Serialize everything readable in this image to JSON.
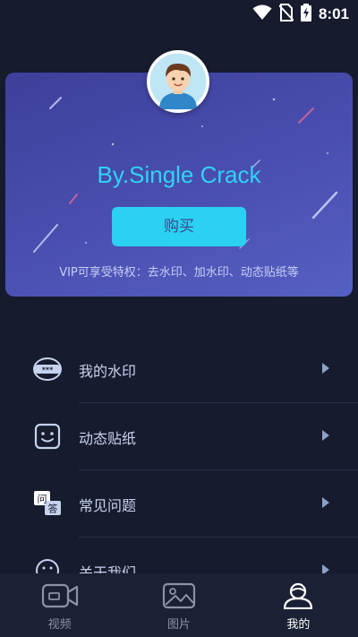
{
  "status_bar": {
    "time": "8:01",
    "icons": [
      "wifi-icon",
      "no-sim-icon",
      "battery-charging-icon"
    ]
  },
  "vip_card": {
    "title": "By.Single Crack",
    "buy_label": "购买",
    "description": "VIP可享受特权：去水印、加水印、动态贴纸等",
    "colors": {
      "title": "#2fd3f5",
      "button": "#2ad1f2",
      "card": "#4a4fb0"
    }
  },
  "menu": {
    "items": [
      {
        "label": "我的水印",
        "icon": "watermark-icon"
      },
      {
        "label": "动态贴纸",
        "icon": "sticker-face-icon"
      },
      {
        "label": "常见问题",
        "icon": "faq-icon"
      },
      {
        "label": "关于我们",
        "icon": "about-icon"
      }
    ]
  },
  "bottom_nav": {
    "tabs": [
      {
        "label": "视频",
        "icon": "video-camera-icon",
        "active": false
      },
      {
        "label": "图片",
        "icon": "image-icon",
        "active": false
      },
      {
        "label": "我的",
        "icon": "user-profile-icon",
        "active": true
      }
    ]
  },
  "faq_icon_glyphs": {
    "top": "问",
    "bottom": "答"
  }
}
